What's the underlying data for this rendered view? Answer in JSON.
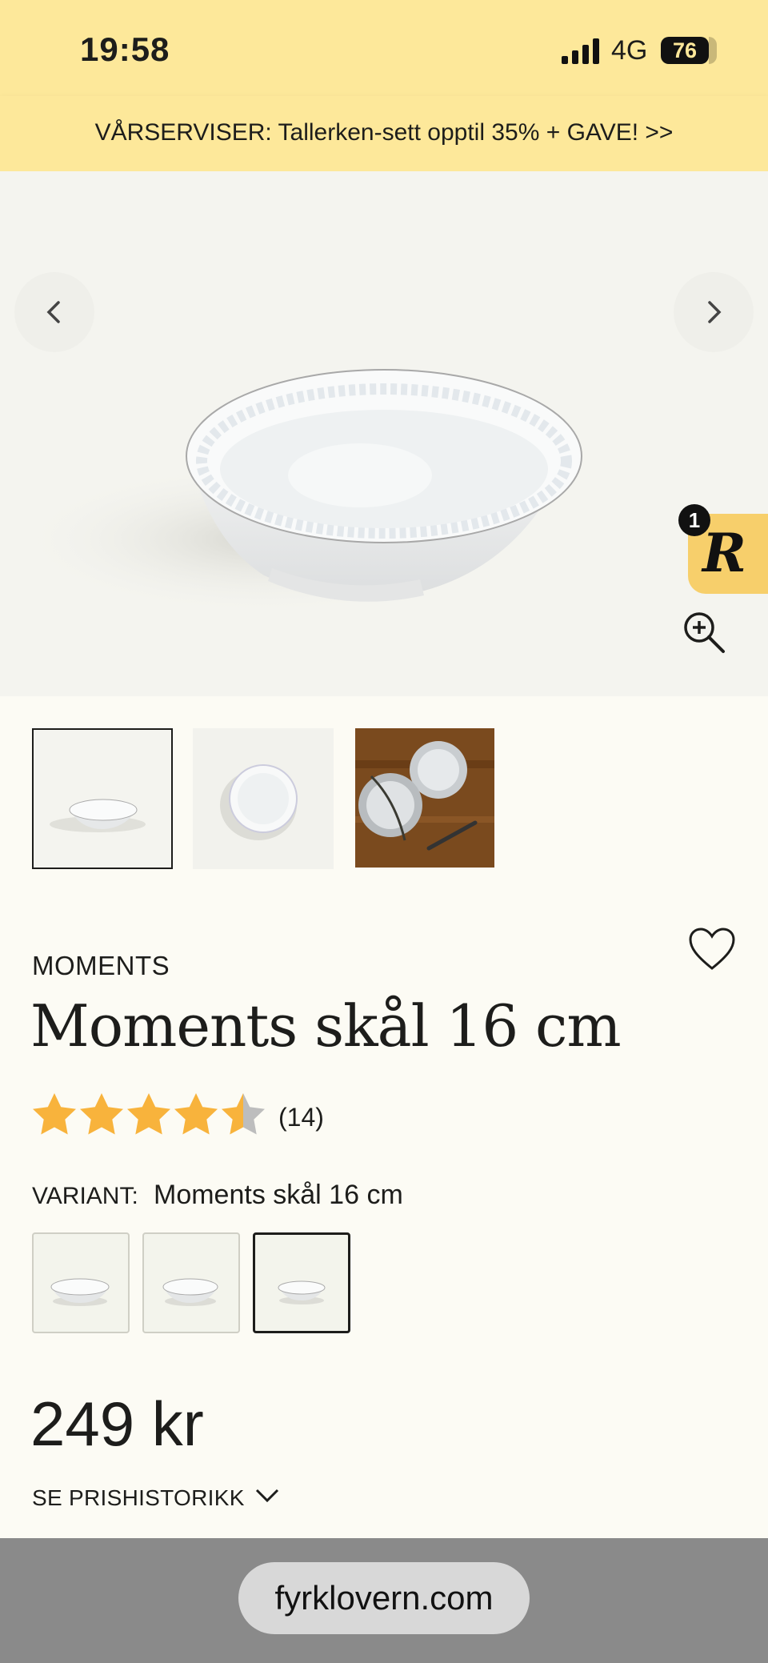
{
  "status_bar": {
    "time": "19:58",
    "network": "4G",
    "battery": "76"
  },
  "promo_banner": {
    "text": "VÅRSERVISER: Tallerken-sett opptil 35% + GAVE! >>"
  },
  "reward": {
    "badge_count": "1",
    "logo_letter": "R"
  },
  "product": {
    "brand": "MOMENTS",
    "title": "Moments skål 16 cm",
    "rating": 4.5,
    "rating_max": 5,
    "review_count": "(14)",
    "variant_label": "VARIANT:",
    "variant_value": "Moments skål 16 cm",
    "price": "249 kr",
    "price_history_label": "SE PRISHISTORIKK"
  },
  "browser": {
    "url": "fyrklovern.com"
  },
  "colors": {
    "banner": "#fde89a",
    "star": "#f8b33c",
    "reward": "#f7cf6b",
    "page_bg": "#fcfbf4"
  }
}
